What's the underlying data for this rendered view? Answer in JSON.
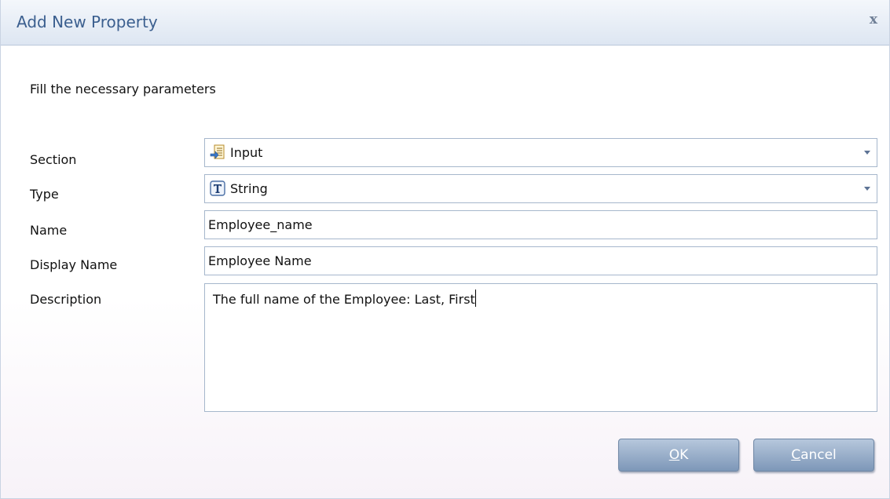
{
  "dialog": {
    "title": "Add New Property",
    "close_symbol": "x",
    "instructions": "Fill the necessary parameters"
  },
  "form": {
    "section": {
      "label": "Section",
      "value": "Input",
      "icon": "input-section-icon"
    },
    "type": {
      "label": "Type",
      "value": "String",
      "icon": "string-type-icon"
    },
    "name": {
      "label": "Name",
      "value": "Employee_name"
    },
    "display_name": {
      "label": "Display Name",
      "value": "Employee Name"
    },
    "description": {
      "label": "Description",
      "value": "The full name of the Employee: Last, First"
    }
  },
  "buttons": {
    "ok": {
      "accelerator": "O",
      "rest": "K"
    },
    "cancel": {
      "accelerator": "C",
      "rest": "ancel"
    }
  },
  "colors": {
    "title_text": "#3b5f8f",
    "button_top": "#b6c7dc",
    "button_bottom": "#7d97b8",
    "field_border": "#a6b7cc"
  }
}
